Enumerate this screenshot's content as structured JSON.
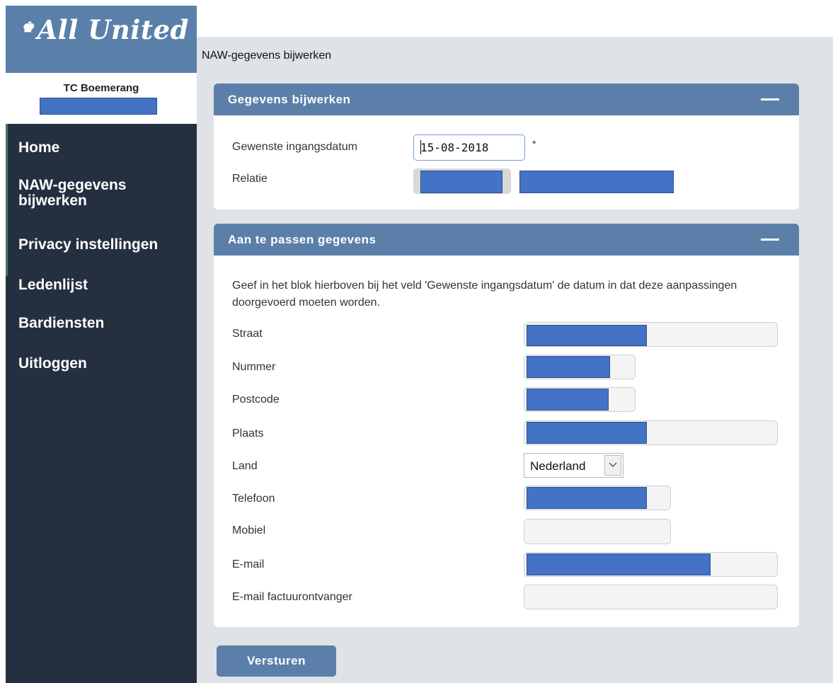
{
  "brand": {
    "logo_text": "All United",
    "crown_glyph": "♚",
    "color": "#5a80aa"
  },
  "club": {
    "name": "TC Boemerang"
  },
  "sidebar": {
    "items": [
      {
        "label": "Home"
      },
      {
        "label": "NAW-gegevens\nbijwerken"
      },
      {
        "label": "Privacy instellingen"
      },
      {
        "label": "Ledenlijst"
      },
      {
        "label": "Bardiensten"
      },
      {
        "label": "Uitloggen"
      }
    ]
  },
  "page": {
    "title": "NAW-gegevens bijwerken"
  },
  "panel1": {
    "title": "Gegevens bijwerken",
    "date_label": "Gewenste ingangsdatum",
    "date_value": "15-08-2018",
    "required_marker": "*",
    "relation_label": "Relatie"
  },
  "panel2": {
    "title": "Aan te passen gegevens",
    "intro": "Geef in het blok hierboven bij het veld 'Gewenste ingangsdatum' de datum in dat deze aanpassingen doorgevoerd moeten worden.",
    "fields": {
      "straat": "Straat",
      "nummer": "Nummer",
      "postcode": "Postcode",
      "plaats": "Plaats",
      "land": "Land",
      "telefoon": "Telefoon",
      "mobiel": "Mobiel",
      "email": "E-mail",
      "email_factuur": "E-mail factuurontvanger"
    },
    "land_value": "Nederland"
  },
  "submit_label": "Versturen",
  "colors": {
    "panel_header": "#5b7fa8",
    "nav_bg": "#24303f",
    "redaction": "#4472c4",
    "page_bg": "#dfe2e6"
  }
}
